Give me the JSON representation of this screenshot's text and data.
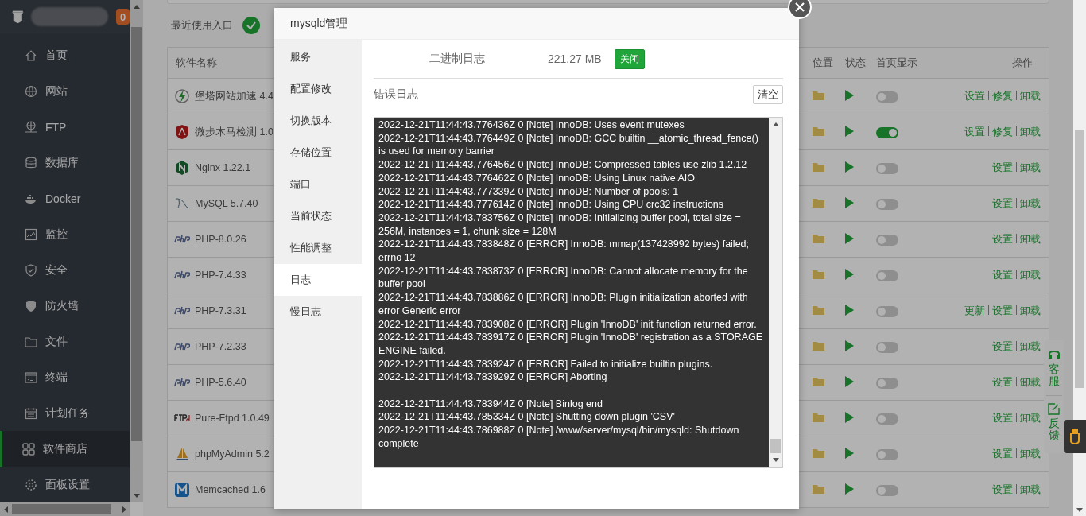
{
  "sidebar": {
    "badge": "0",
    "items": [
      {
        "label": "首页",
        "kind": "home",
        "selected": false
      },
      {
        "label": "网站",
        "kind": "globe",
        "selected": false
      },
      {
        "label": "FTP",
        "kind": "ftp",
        "selected": false
      },
      {
        "label": "数据库",
        "kind": "database",
        "selected": false
      },
      {
        "label": "Docker",
        "kind": "docker",
        "selected": false
      },
      {
        "label": "监控",
        "kind": "monitor",
        "selected": false
      },
      {
        "label": "安全",
        "kind": "shield",
        "selected": false
      },
      {
        "label": "防火墙",
        "kind": "firewall",
        "selected": false
      },
      {
        "label": "文件",
        "kind": "folder",
        "selected": false
      },
      {
        "label": "终端",
        "kind": "terminal",
        "selected": false
      },
      {
        "label": "计划任务",
        "kind": "calendar",
        "selected": false
      },
      {
        "label": "软件商店",
        "kind": "grid",
        "selected": true
      },
      {
        "label": "面板设置",
        "kind": "gear",
        "selected": false
      }
    ]
  },
  "recent": {
    "label": "最近使用入口"
  },
  "table": {
    "columns": [
      "软件名称",
      "位置",
      "状态",
      "首页显示",
      "操作"
    ],
    "rows": [
      {
        "name": "堡塔网站加速 4.4",
        "kind": "bolt",
        "home_display": false,
        "actions": [
          "设置",
          "修复",
          "卸载"
        ]
      },
      {
        "name": "微步木马检测 1.0",
        "kind": "shield",
        "home_display": true,
        "actions": [
          "设置",
          "修复",
          "卸载"
        ]
      },
      {
        "name": "Nginx 1.22.1",
        "kind": "nginx",
        "home_display": false,
        "actions": [
          "设置",
          "卸载"
        ]
      },
      {
        "name": "MySQL 5.7.40",
        "kind": "mysql",
        "home_display": false,
        "actions": [
          "设置",
          "卸载"
        ]
      },
      {
        "name": "PHP-8.0.26",
        "kind": "php",
        "home_display": false,
        "actions": [
          "设置",
          "卸载"
        ]
      },
      {
        "name": "PHP-7.4.33",
        "kind": "php",
        "home_display": false,
        "actions": [
          "设置",
          "卸载"
        ]
      },
      {
        "name": "PHP-7.3.31",
        "kind": "php",
        "home_display": false,
        "actions": [
          "更新",
          "设置",
          "卸载"
        ]
      },
      {
        "name": "PHP-7.2.33",
        "kind": "php",
        "home_display": false,
        "actions": [
          "设置",
          "卸载"
        ]
      },
      {
        "name": "PHP-5.6.40",
        "kind": "php",
        "home_display": false,
        "actions": [
          "设置",
          "卸载"
        ]
      },
      {
        "name": "Pure-Ftpd 1.0.49",
        "kind": "ftpd",
        "home_display": false,
        "actions": [
          "设置",
          "卸载"
        ]
      },
      {
        "name": "phpMyAdmin 5.2",
        "kind": "sailboat",
        "home_display": false,
        "actions": [
          "设置",
          "卸载"
        ]
      },
      {
        "name": "Memcached 1.6",
        "kind": "memcached",
        "home_display": false,
        "actions": [
          "设置",
          "卸载"
        ]
      }
    ]
  },
  "float_widget": {
    "items": [
      "客服",
      "反馈"
    ]
  },
  "modal": {
    "title": "mysqld管理",
    "nav": [
      {
        "label": "服务",
        "selected": false
      },
      {
        "label": "配置修改",
        "selected": false
      },
      {
        "label": "切换版本",
        "selected": false
      },
      {
        "label": "存储位置",
        "selected": false
      },
      {
        "label": "端口",
        "selected": false
      },
      {
        "label": "当前状态",
        "selected": false
      },
      {
        "label": "性能调整",
        "selected": false
      },
      {
        "label": "日志",
        "selected": true
      },
      {
        "label": "慢日志",
        "selected": false
      }
    ],
    "binlog": {
      "label": "二进制日志",
      "size": "221.27 MB",
      "button": "关闭"
    },
    "error_log": {
      "label": "错误日志",
      "clear_button": "清空",
      "text": "2022-12-21T11:44:43.776436Z 0 [Note] InnoDB: Uses event mutexes\n2022-12-21T11:44:43.776449Z 0 [Note] InnoDB: GCC builtin __atomic_thread_fence() is used for memory barrier\n2022-12-21T11:44:43.776456Z 0 [Note] InnoDB: Compressed tables use zlib 1.2.12\n2022-12-21T11:44:43.776462Z 0 [Note] InnoDB: Using Linux native AIO\n2022-12-21T11:44:43.777339Z 0 [Note] InnoDB: Number of pools: 1\n2022-12-21T11:44:43.777614Z 0 [Note] InnoDB: Using CPU crc32 instructions\n2022-12-21T11:44:43.783756Z 0 [Note] InnoDB: Initializing buffer pool, total size = 256M, instances = 1, chunk size = 128M\n2022-12-21T11:44:43.783848Z 0 [ERROR] InnoDB: mmap(137428992 bytes) failed; errno 12\n2022-12-21T11:44:43.783873Z 0 [ERROR] InnoDB: Cannot allocate memory for the buffer pool\n2022-12-21T11:44:43.783886Z 0 [ERROR] InnoDB: Plugin initialization aborted with error Generic error\n2022-12-21T11:44:43.783908Z 0 [ERROR] Plugin 'InnoDB' init function returned error.\n2022-12-21T11:44:43.783917Z 0 [ERROR] Plugin 'InnoDB' registration as a STORAGE ENGINE failed.\n2022-12-21T11:44:43.783924Z 0 [ERROR] Failed to initialize builtin plugins.\n2022-12-21T11:44:43.783929Z 0 [ERROR] Aborting\n\n2022-12-21T11:44:43.783944Z 0 [Note] Binlog end\n2022-12-21T11:44:43.785334Z 0 [Note] Shutting down plugin 'CSV'\n2022-12-21T11:44:43.786988Z 0 [Note] /www/server/mysql/bin/mysqld: Shutdown complete"
    }
  }
}
